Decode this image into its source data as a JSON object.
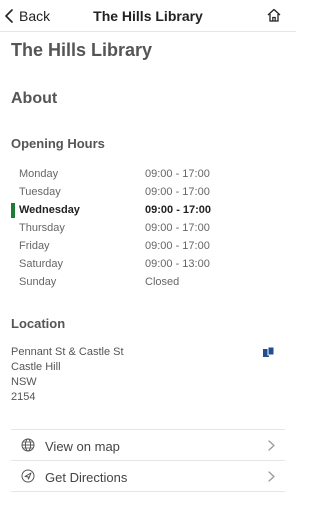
{
  "navbar": {
    "back_label": "Back",
    "title": "The Hills Library"
  },
  "page": {
    "title": "The Hills Library",
    "section": "About"
  },
  "hours": {
    "heading": "Opening Hours",
    "rows": [
      {
        "day": "Monday",
        "time": "09:00 - 17:00"
      },
      {
        "day": "Tuesday",
        "time": "09:00 - 17:00"
      },
      {
        "day": "Wednesday",
        "time": "09:00 - 17:00"
      },
      {
        "day": "Thursday",
        "time": "09:00 - 17:00"
      },
      {
        "day": "Friday",
        "time": "09:00 - 17:00"
      },
      {
        "day": "Saturday",
        "time": "09:00 - 13:00"
      },
      {
        "day": "Sunday",
        "time": "Closed"
      }
    ]
  },
  "location": {
    "heading": "Location",
    "address": [
      "Pennant St & Castle St",
      "Castle Hill",
      "NSW",
      "2154"
    ]
  },
  "actions": {
    "view_map": "View on map",
    "directions": "Get Directions"
  },
  "colors": {
    "today_marker": "#1e7d34",
    "copy_icon": "#1f4f8f"
  }
}
